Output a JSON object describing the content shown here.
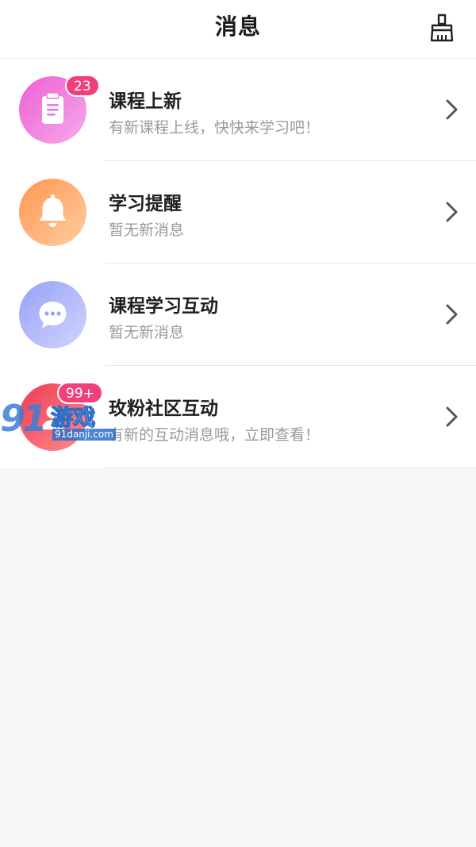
{
  "header": {
    "title": "消息",
    "clear_icon": "broom-icon"
  },
  "items": [
    {
      "title": "课程上新",
      "subtitle": "有新课程上线，快快来学习吧！",
      "badge": "23",
      "icon": "clipboard-icon",
      "gradient": [
        "#f06ad8",
        "#f7a6ea"
      ]
    },
    {
      "title": "学习提醒",
      "subtitle": "暂无新消息",
      "badge": "",
      "icon": "bell-icon",
      "gradient": [
        "#ff9a55",
        "#ffc89a"
      ]
    },
    {
      "title": "课程学习互动",
      "subtitle": "暂无新消息",
      "badge": "",
      "icon": "chat-bubble-icon",
      "gradient": [
        "#9aa5f8",
        "#c9cffc"
      ]
    },
    {
      "title": "玫粉社区互动",
      "subtitle": "有新的互动消息哦，立即查看！",
      "badge": "99+",
      "icon": "community-icon",
      "gradient": [
        "#f0405a",
        "#ff8a8a"
      ]
    }
  ],
  "watermark": {
    "number": "91",
    "text": "游戏",
    "url": "91danji.com"
  },
  "colors": {
    "accent": "#f0407a",
    "title_text": "#1f1f1f",
    "subtitle_text": "#9a9a9a",
    "background": "#f7f7f8"
  }
}
